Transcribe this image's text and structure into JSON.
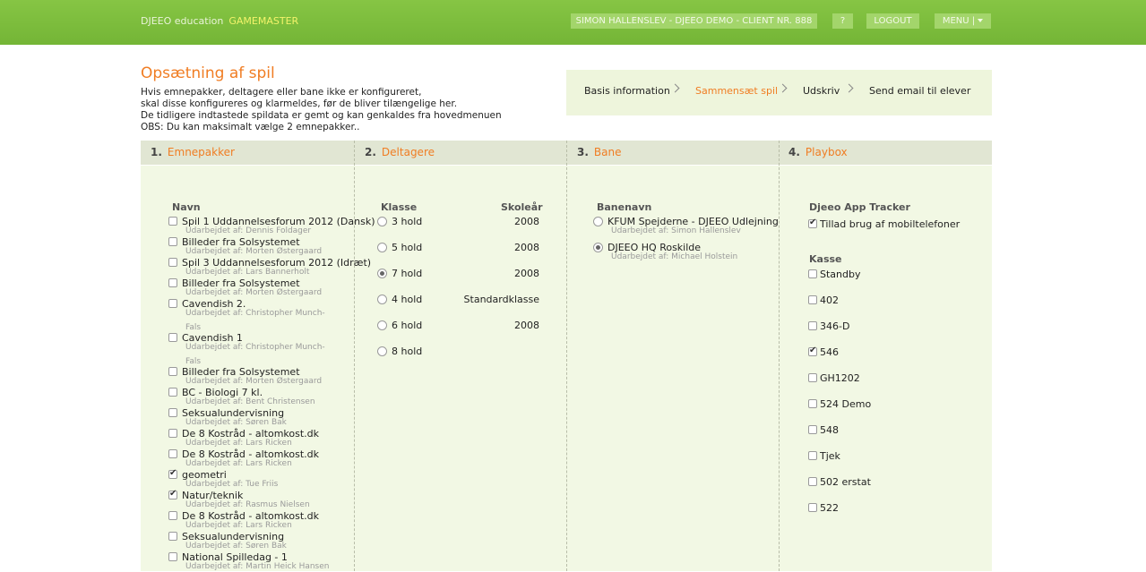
{
  "header": {
    "brand": "DJEEO education",
    "role": "GAMEMASTER",
    "user": "SIMON HALLENSLEV - DJEEO DEMO - CLIENT NR. 888",
    "help": "?",
    "logout": "LOGOUT",
    "menu": "MENU |"
  },
  "page": {
    "title": "Opsætning af spil",
    "intro": [
      "Hvis emnepakker, deltagere eller bane ikke er konfigureret,",
      "skal disse konfigureres og klarmeldes, før de bliver tilængelige her.",
      "De tidligere indtastede spildata er gemt og kan genkaldes fra hovedmenuen",
      "OBS: Du kan maksimalt vælge 2 emnepakker.."
    ]
  },
  "steps": [
    "Basis information",
    "Sammensæt spil",
    "Udskriv",
    "Send email til elever"
  ],
  "columns": [
    {
      "num": "1.",
      "title": "Emnepakker"
    },
    {
      "num": "2.",
      "title": "Deltagere"
    },
    {
      "num": "3.",
      "title": "Bane"
    },
    {
      "num": "4.",
      "title": "Playbox"
    }
  ],
  "emnepakker": {
    "header": "Navn",
    "items": [
      {
        "name": "Spil 1 Uddannelsesforum 2012 (Dansk)",
        "by": "Udarbejdet af: Dennis Foldager",
        "checked": false
      },
      {
        "name": "Billeder fra Solsystemet",
        "by": "Udarbejdet af: Morten Østergaard",
        "checked": false
      },
      {
        "name": "Spil 3 Uddannelsesforum 2012 (Idræt)",
        "by": "Udarbejdet af: Lars Bannerholt",
        "checked": false
      },
      {
        "name": "Billeder fra Solsystemet",
        "by": "Udarbejdet af: Morten Østergaard",
        "checked": false
      },
      {
        "name": "Cavendish 2.",
        "by": "Udarbejdet af: Christopher Munch-",
        "by2": "Fals",
        "checked": false
      },
      {
        "name": "Cavendish 1",
        "by": "Udarbejdet af: Christopher Munch-",
        "by2": "Fals",
        "checked": false
      },
      {
        "name": "Billeder fra Solsystemet",
        "by": "Udarbejdet af: Morten Østergaard",
        "checked": false
      },
      {
        "name": "BC - Biologi 7 kl.",
        "by": "Udarbejdet af: Bent Christensen",
        "checked": false
      },
      {
        "name": "Seksualundervisning",
        "by": "Udarbejdet af: Søren Bak",
        "checked": false
      },
      {
        "name": "De 8 Kostråd - altomkost.dk",
        "by": "Udarbejdet af: Lars Ricken",
        "checked": false
      },
      {
        "name": "De 8 Kostråd - altomkost.dk",
        "by": "Udarbejdet af: Lars Ricken",
        "checked": false
      },
      {
        "name": "geometri",
        "by": "Udarbejdet af: Tue Friis",
        "checked": true
      },
      {
        "name": "Natur/teknik",
        "by": "Udarbejdet af: Rasmus Nielsen",
        "checked": true
      },
      {
        "name": "De 8 Kostråd - altomkost.dk",
        "by": "Udarbejdet af: Lars Ricken",
        "checked": false
      },
      {
        "name": "Seksualundervisning",
        "by": "Udarbejdet af: Søren Bak",
        "checked": false
      },
      {
        "name": "National Spilledag - 1",
        "by": "Udarbejdet af: Martin Heick Hansen",
        "checked": false
      }
    ]
  },
  "deltagere": {
    "header_class": "Klasse",
    "header_year": "Skoleår",
    "items": [
      {
        "name": "3 hold",
        "year": "2008",
        "selected": false
      },
      {
        "name": "5 hold",
        "year": "2008",
        "selected": false
      },
      {
        "name": "7 hold",
        "year": "2008",
        "selected": true
      },
      {
        "name": "4 hold",
        "year": "Standardklasse",
        "selected": false
      },
      {
        "name": "6 hold",
        "year": "2008",
        "selected": false
      },
      {
        "name": "8 hold",
        "year": "",
        "selected": false
      }
    ]
  },
  "bane": {
    "header": "Banenavn",
    "items": [
      {
        "name": "KFUM Spejderne - DJEEO Udlejning",
        "by": "Udarbejdet af: Simon Hallenslev",
        "selected": false
      },
      {
        "name": "DJEEO HQ Roskilde",
        "by": "Udarbejdet af: Michael Holstein",
        "selected": true
      }
    ]
  },
  "playbox": {
    "tracker_header": "Djeeo App Tracker",
    "tracker_label": "Tillad brug af mobiltelefoner",
    "tracker_checked": true,
    "kasse_header": "Kasse",
    "items": [
      {
        "name": "Standby",
        "checked": false
      },
      {
        "name": "402",
        "checked": false
      },
      {
        "name": "346-D",
        "checked": false
      },
      {
        "name": "546",
        "checked": true
      },
      {
        "name": "GH1202",
        "checked": false
      },
      {
        "name": "524 Demo",
        "checked": false
      },
      {
        "name": "548",
        "checked": false
      },
      {
        "name": "Tjek",
        "checked": false
      },
      {
        "name": "502 erstat",
        "checked": false
      },
      {
        "name": "522",
        "checked": false
      }
    ]
  }
}
